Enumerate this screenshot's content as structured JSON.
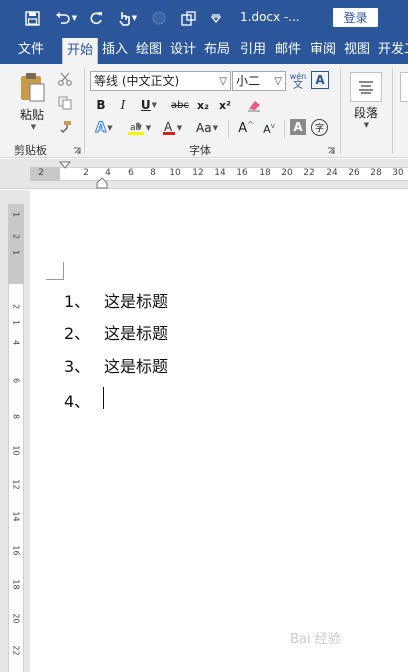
{
  "titlebar": {
    "title": "1.docx  -...",
    "login_label": "登录",
    "accent": "#2b579a"
  },
  "tabs": [
    {
      "label": "文件"
    },
    {
      "label": "开始"
    },
    {
      "label": "插入"
    },
    {
      "label": "绘图"
    },
    {
      "label": "设计"
    },
    {
      "label": "布局"
    },
    {
      "label": "引用"
    },
    {
      "label": "邮件"
    },
    {
      "label": "审阅"
    },
    {
      "label": "视图"
    },
    {
      "label": "开发工"
    }
  ],
  "ribbon": {
    "clipboard": {
      "paste_label": "粘贴",
      "group_label": "剪贴板"
    },
    "font": {
      "font_name": "等线 (中文正文)",
      "font_size": "小二",
      "group_label": "字体",
      "bold": "B",
      "italic": "I",
      "underline": "U",
      "strikethrough": "abc",
      "subscript": "x₂",
      "superscript": "x²",
      "change_case": "Aa",
      "grow_font": "A",
      "shrink_font": "A",
      "phonetic_top": "wén",
      "phonetic_bottom": "文",
      "enclosed": "字"
    },
    "paragraph": {
      "group_label": "段落"
    }
  },
  "hruler": {
    "ticks": [
      "2",
      "2",
      "4",
      "6",
      "8",
      "10",
      "12",
      "14",
      "16",
      "18",
      "20",
      "22",
      "24",
      "26",
      "28",
      "30"
    ]
  },
  "vruler": {
    "ticks": [
      "1",
      "2",
      "1",
      "2",
      "1",
      "4",
      "6",
      "8",
      "10",
      "12",
      "14",
      "16",
      "18",
      "20",
      "22"
    ]
  },
  "document": {
    "items": [
      {
        "number": "1、",
        "text": "这是标题"
      },
      {
        "number": "2、",
        "text": "这是标题"
      },
      {
        "number": "3、",
        "text": "这是标题"
      },
      {
        "number": "4、",
        "text": ""
      }
    ]
  },
  "watermark": "Bai 经验"
}
